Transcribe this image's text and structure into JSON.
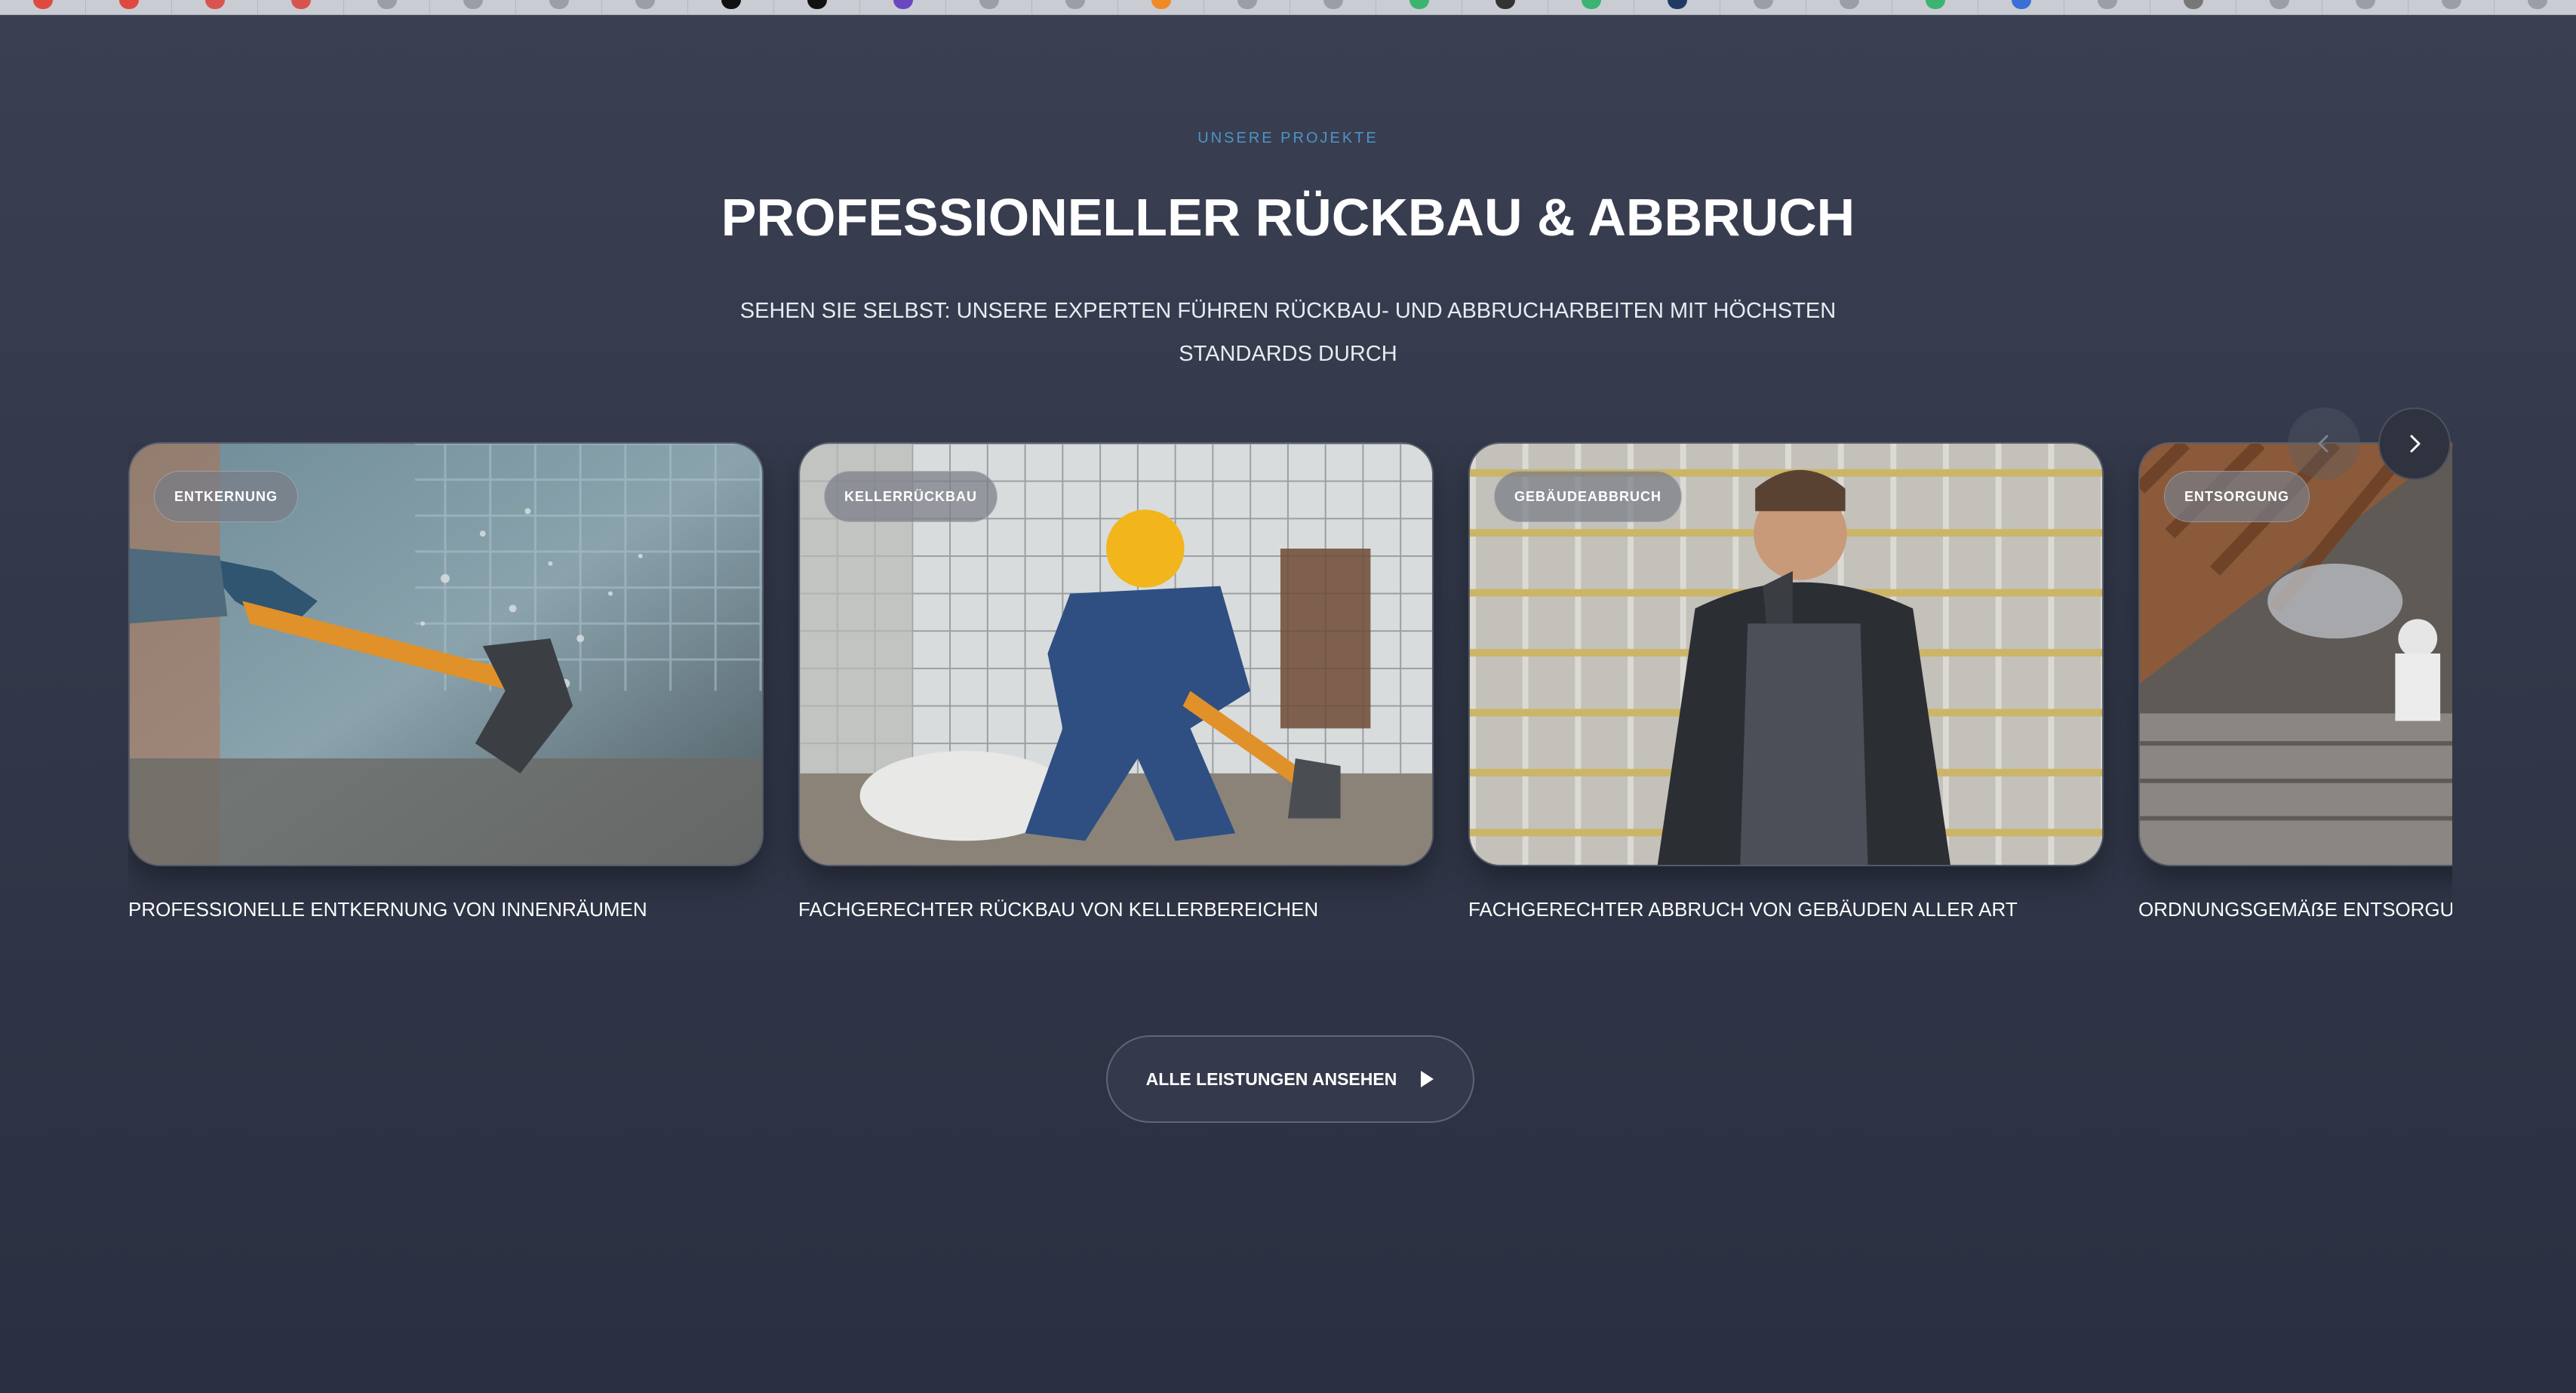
{
  "browser": {
    "tabs": [
      {
        "icon": "red-x-icon",
        "color": "#e0493f"
      },
      {
        "icon": "red-x-icon",
        "color": "#e0493f"
      },
      {
        "icon": "multicolor-icon",
        "color": "#d9534f"
      },
      {
        "icon": "multicolor-icon",
        "color": "#d9534f"
      },
      {
        "icon": "generic-favicon",
        "color": "#9a9ea6"
      },
      {
        "icon": "generic-favicon",
        "color": "#9a9ea6"
      },
      {
        "icon": "generic-favicon",
        "color": "#9a9ea6"
      },
      {
        "icon": "generic-favicon",
        "color": "#9a9ea6"
      },
      {
        "icon": "black-circle-icon",
        "color": "#111111"
      },
      {
        "icon": "black-circle-icon",
        "color": "#111111"
      },
      {
        "icon": "purple-icon",
        "color": "#6b46c1"
      },
      {
        "icon": "generic-favicon",
        "color": "#9a9ea6"
      },
      {
        "icon": "generic-favicon",
        "color": "#9a9ea6"
      },
      {
        "icon": "orange-icon",
        "color": "#f08a24"
      },
      {
        "icon": "generic-favicon",
        "color": "#9a9ea6"
      },
      {
        "icon": "generic-favicon",
        "color": "#9a9ea6"
      },
      {
        "icon": "green-icon",
        "color": "#3cb371"
      },
      {
        "icon": "dark-icon",
        "color": "#333333"
      },
      {
        "icon": "green-icon",
        "color": "#3cb371"
      },
      {
        "icon": "navy-icon",
        "color": "#1f3b63"
      },
      {
        "icon": "generic-favicon",
        "color": "#9a9ea6"
      },
      {
        "icon": "generic-favicon",
        "color": "#9a9ea6"
      },
      {
        "icon": "green-icon",
        "color": "#3cb371"
      },
      {
        "icon": "blue-icon",
        "color": "#3b6fd6"
      },
      {
        "icon": "generic-favicon",
        "color": "#9a9ea6"
      },
      {
        "icon": "star-icon",
        "color": "#777777"
      },
      {
        "icon": "generic-favicon",
        "color": "#9a9ea6"
      },
      {
        "icon": "generic-favicon",
        "color": "#9a9ea6"
      },
      {
        "icon": "generic-favicon",
        "color": "#9a9ea6"
      },
      {
        "icon": "generic-favicon",
        "color": "#9a9ea6"
      }
    ]
  },
  "section": {
    "eyebrow": "UNSERE PROJEKTE",
    "title": "PROFESSIONELLER RÜCKBAU & ABBRUCH",
    "subtitle": "SEHEN SIE SELBST: UNSERE EXPERTEN FÜHREN RÜCKBAU- UND ABBRUCHARBEITEN MIT HÖCHSTEN STANDARDS DURCH",
    "accent_color": "#4f93c6"
  },
  "carousel": {
    "prev_icon": "chevron-left-icon",
    "next_icon": "chevron-right-icon",
    "cards": [
      {
        "badge": "ENTKERNUNG",
        "caption": "PROFESSIONELLE ENTKERNUNG VON INNENRÄUMEN",
        "image": "worker-hammer-tiles"
      },
      {
        "badge": "KELLERRÜCKBAU",
        "caption": "FACHGERECHTER RÜCKBAU VON KELLERBEREICHEN",
        "image": "worker-hardhat-basement"
      },
      {
        "badge": "GEBÄUDEABBRUCH",
        "caption": "FACHGERECHTER ABBRUCH VON GEBÄUDEN ALLER ART",
        "image": "worker-phone-scaffolding"
      },
      {
        "badge": "ENTSORGUNG",
        "caption": "ORDNUNGSGEMÄẞE ENTSORGUNG",
        "image": "attic-insulation-removal"
      }
    ]
  },
  "cta": {
    "label": "ALLE LEISTUNGEN ANSEHEN",
    "icon": "play-arrow-icon"
  }
}
